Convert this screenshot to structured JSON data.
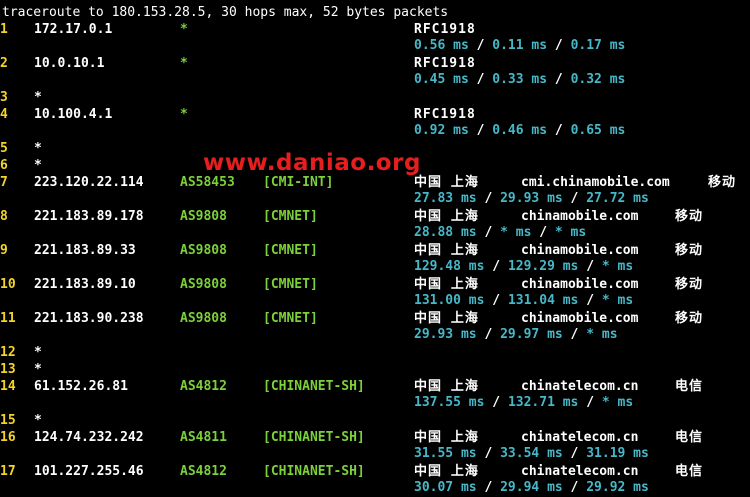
{
  "header": "traceroute to 180.153.28.5, 30 hops max, 52 bytes packets",
  "watermark": "www.daniao.org",
  "colors": {
    "hop_number": "#f2d42a",
    "as": "#7cd039",
    "latency": "#46b8c8",
    "watermark": "#e61e1e",
    "background": "#000000"
  },
  "hops": [
    {
      "num": "1",
      "ip": "172.17.0.1",
      "as": "*",
      "net": "",
      "geo": "RFC1918",
      "host": "",
      "isp": "",
      "times": [
        "0.56 ms",
        "0.11 ms",
        "0.17 ms"
      ]
    },
    {
      "num": "2",
      "ip": "10.0.10.1",
      "as": "*",
      "net": "",
      "geo": "RFC1918",
      "host": "",
      "isp": "",
      "times": [
        "0.45 ms",
        "0.33 ms",
        "0.32 ms"
      ]
    },
    {
      "num": "3",
      "ip": "*",
      "as": "",
      "net": "",
      "geo": "",
      "host": "",
      "isp": "",
      "times": []
    },
    {
      "num": "4",
      "ip": "10.100.4.1",
      "as": "*",
      "net": "",
      "geo": "RFC1918",
      "host": "",
      "isp": "",
      "times": [
        "0.92 ms",
        "0.46 ms",
        "0.65 ms"
      ]
    },
    {
      "num": "5",
      "ip": "*",
      "as": "",
      "net": "",
      "geo": "",
      "host": "",
      "isp": "",
      "times": []
    },
    {
      "num": "6",
      "ip": "*",
      "as": "",
      "net": "",
      "geo": "",
      "host": "",
      "isp": "",
      "times": []
    },
    {
      "num": "7",
      "ip": "223.120.22.114",
      "as": "AS58453",
      "net": "[CMI-INT]",
      "geo": "中国 上海",
      "host": "cmi.chinamobile.com",
      "isp": "移动",
      "times": [
        "27.83 ms",
        "29.93 ms",
        "27.72 ms"
      ]
    },
    {
      "num": "8",
      "ip": "221.183.89.178",
      "as": "AS9808",
      "net": "[CMNET]",
      "geo": "中国 上海",
      "host": "chinamobile.com",
      "isp": "移动",
      "times": [
        "28.88 ms",
        "* ms",
        "* ms"
      ]
    },
    {
      "num": "9",
      "ip": "221.183.89.33",
      "as": "AS9808",
      "net": "[CMNET]",
      "geo": "中国 上海",
      "host": "chinamobile.com",
      "isp": "移动",
      "times": [
        "129.48 ms",
        "129.29 ms",
        "* ms"
      ]
    },
    {
      "num": "10",
      "ip": "221.183.89.10",
      "as": "AS9808",
      "net": "[CMNET]",
      "geo": "中国 上海",
      "host": "chinamobile.com",
      "isp": "移动",
      "times": [
        "131.00 ms",
        "131.04 ms",
        "* ms"
      ]
    },
    {
      "num": "11",
      "ip": "221.183.90.238",
      "as": "AS9808",
      "net": "[CMNET]",
      "geo": "中国 上海",
      "host": "chinamobile.com",
      "isp": "移动",
      "times": [
        "29.93 ms",
        "29.97 ms",
        "* ms"
      ]
    },
    {
      "num": "12",
      "ip": "*",
      "as": "",
      "net": "",
      "geo": "",
      "host": "",
      "isp": "",
      "times": []
    },
    {
      "num": "13",
      "ip": "*",
      "as": "",
      "net": "",
      "geo": "",
      "host": "",
      "isp": "",
      "times": []
    },
    {
      "num": "14",
      "ip": "61.152.26.81",
      "as": "AS4812",
      "net": "[CHINANET-SH]",
      "geo": "中国 上海",
      "host": "chinatelecom.cn",
      "isp": "电信",
      "times": [
        "137.55 ms",
        "132.71 ms",
        "* ms"
      ]
    },
    {
      "num": "15",
      "ip": "*",
      "as": "",
      "net": "",
      "geo": "",
      "host": "",
      "isp": "",
      "times": []
    },
    {
      "num": "16",
      "ip": "124.74.232.242",
      "as": "AS4811",
      "net": "[CHINANET-SH]",
      "geo": "中国 上海",
      "host": "chinatelecom.cn",
      "isp": "电信",
      "times": [
        "31.55 ms",
        "33.54 ms",
        "31.19 ms"
      ]
    },
    {
      "num": "17",
      "ip": "101.227.255.46",
      "as": "AS4812",
      "net": "[CHINANET-SH]",
      "geo": "中国 上海",
      "host": "chinatelecom.cn",
      "isp": "电信",
      "times": [
        "30.07 ms",
        "29.94 ms",
        "29.92 ms"
      ]
    }
  ]
}
